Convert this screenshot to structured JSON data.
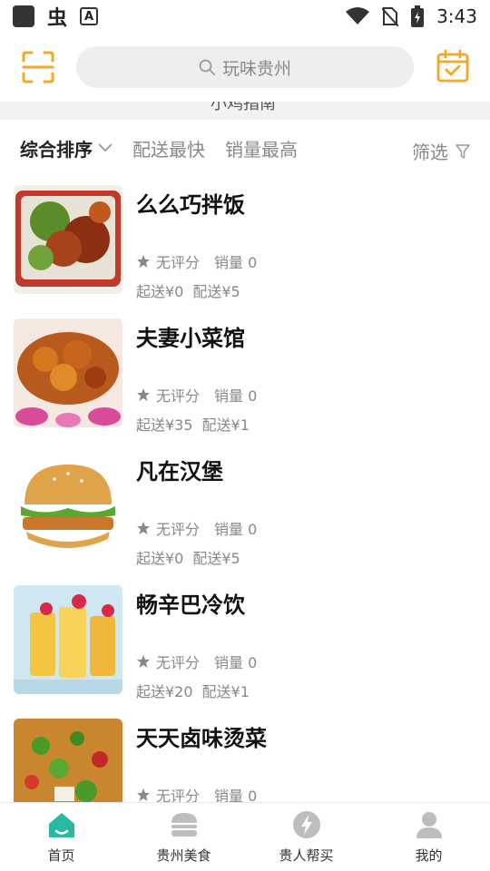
{
  "status_bar": {
    "time": "3:43",
    "icons": [
      "app-icon",
      "bug-icon",
      "a-icon",
      "wifi-icon",
      "no-sim-icon",
      "battery-icon"
    ]
  },
  "header": {
    "scan_icon": "scan-icon",
    "search_placeholder": "玩味贵州",
    "calendar_icon": "calendar-check-icon"
  },
  "strip": {
    "text": "小鸡指南"
  },
  "sortbar": {
    "items": [
      {
        "label": "综合排序",
        "active": true
      },
      {
        "label": "配送最快",
        "active": false
      },
      {
        "label": "销量最高",
        "active": false
      }
    ],
    "filter_label": "筛选"
  },
  "stores": [
    {
      "name": "么么巧拌饭",
      "rating": "无评分",
      "sales": "销量 0",
      "min_order": "起送¥0",
      "delivery": "配送¥5",
      "image": "stir-fry-plate"
    },
    {
      "name": "夫妻小菜馆",
      "rating": "无评分",
      "sales": "销量 0",
      "min_order": "起送¥35",
      "delivery": "配送¥1",
      "image": "spicy-chicken"
    },
    {
      "name": "凡在汉堡",
      "rating": "无评分",
      "sales": "销量 0",
      "min_order": "起送¥0",
      "delivery": "配送¥5",
      "image": "burger"
    },
    {
      "name": "畅辛巴冷饮",
      "rating": "无评分",
      "sales": "销量 0",
      "min_order": "起送¥20",
      "delivery": "配送¥1",
      "image": "cold-drinks"
    },
    {
      "name": "天天卤味烫菜",
      "rating": "无评分",
      "sales": "销量 0",
      "min_order": "",
      "delivery": "",
      "image": "braised-vegetables"
    }
  ],
  "bottom_nav": [
    {
      "label": "首页",
      "icon": "home-icon",
      "active": true
    },
    {
      "label": "贵州美食",
      "icon": "burger-icon",
      "active": false
    },
    {
      "label": "贵人帮买",
      "icon": "lightning-icon",
      "active": false
    },
    {
      "label": "我的",
      "icon": "user-icon",
      "active": false
    }
  ],
  "colors": {
    "accent": "#f5a623",
    "nav_active": "#2bb7a0",
    "muted": "#888888"
  }
}
